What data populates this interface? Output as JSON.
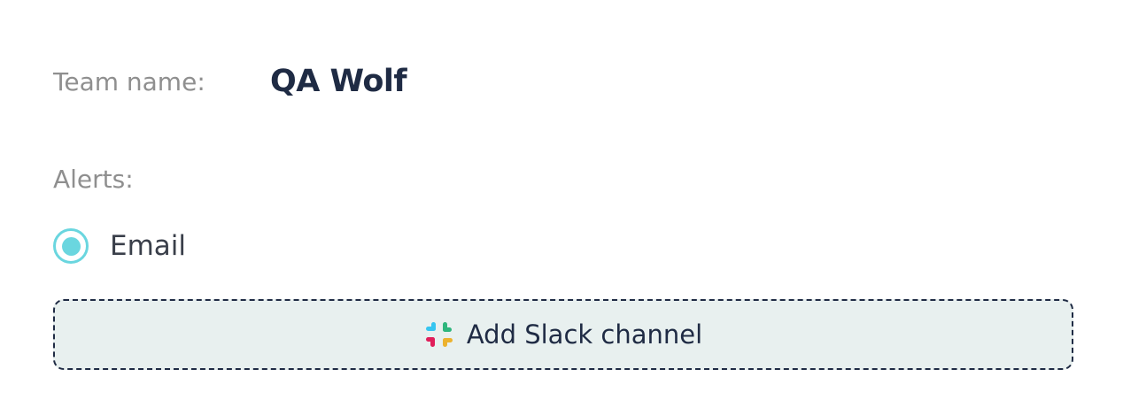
{
  "team": {
    "label": "Team name:",
    "name": "QA Wolf"
  },
  "alerts": {
    "label": "Alerts:",
    "email_option": {
      "label": "Email",
      "selected": true
    },
    "slack_button": {
      "label": "Add Slack channel",
      "icon": "slack-icon"
    }
  },
  "colors": {
    "accent": "#6ad6df",
    "text_dark": "#1f2b44",
    "text_muted": "#8f8f8f",
    "button_bg": "#e8f0ef"
  }
}
